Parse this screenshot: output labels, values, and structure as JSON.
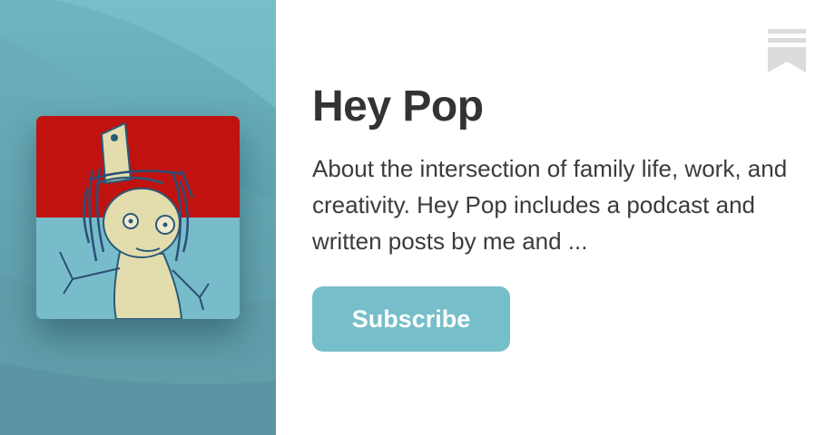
{
  "publication": {
    "title": "Hey Pop",
    "description": "About the intersection of family life, work, and creativity. Hey Pop includes a podcast and written posts by me and ..."
  },
  "subscribe": {
    "label": "Subscribe"
  },
  "icons": {
    "bookmark": "bookmark-icon"
  },
  "colors": {
    "accent": "#76bec9",
    "left_panel": "#6aafbb",
    "cover_red": "#c0120e",
    "cover_blue": "#78bccb",
    "title_text": "#333333"
  }
}
